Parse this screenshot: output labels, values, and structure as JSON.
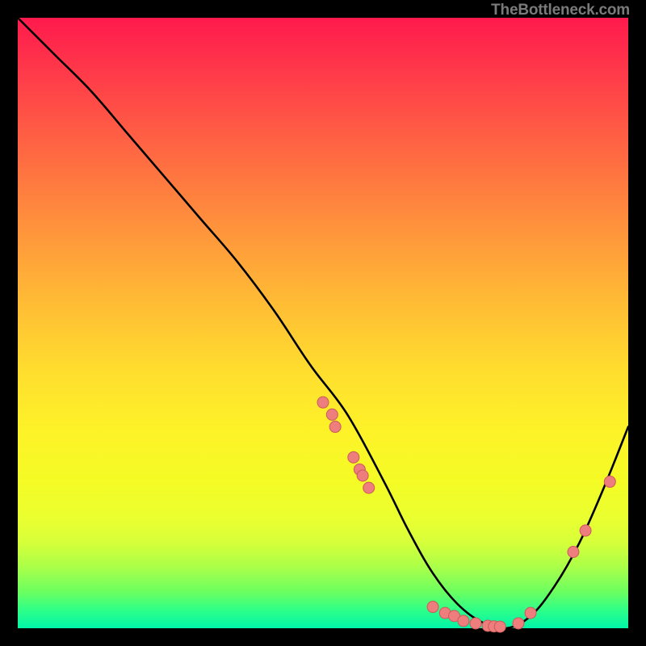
{
  "attribution": "TheBottleneck.com",
  "chart_data": {
    "type": "line",
    "title": "",
    "xlabel": "",
    "ylabel": "",
    "xlim": [
      0,
      100
    ],
    "ylim": [
      0,
      100
    ],
    "series": [
      {
        "name": "curve",
        "x": [
          0,
          6,
          12,
          18,
          24,
          30,
          36,
          42,
          48,
          54,
          60,
          64,
          68,
          72,
          76,
          80,
          84,
          88,
          92,
          96,
          100
        ],
        "values": [
          100,
          94,
          88,
          81,
          74,
          67,
          60,
          52,
          43,
          35,
          24,
          16,
          9,
          4,
          1,
          0,
          2,
          7,
          14,
          23,
          33
        ]
      }
    ],
    "markers": [
      {
        "x": 50,
        "y": 37
      },
      {
        "x": 51.5,
        "y": 35
      },
      {
        "x": 52,
        "y": 33
      },
      {
        "x": 55,
        "y": 28
      },
      {
        "x": 56,
        "y": 26
      },
      {
        "x": 56.5,
        "y": 25
      },
      {
        "x": 57.5,
        "y": 23
      },
      {
        "x": 68,
        "y": 3.5
      },
      {
        "x": 70,
        "y": 2.5
      },
      {
        "x": 71.5,
        "y": 2
      },
      {
        "x": 73,
        "y": 1.2
      },
      {
        "x": 75,
        "y": 0.8
      },
      {
        "x": 77,
        "y": 0.4
      },
      {
        "x": 78,
        "y": 0.3
      },
      {
        "x": 79,
        "y": 0.25
      },
      {
        "x": 82,
        "y": 0.8
      },
      {
        "x": 84,
        "y": 2.5
      },
      {
        "x": 91,
        "y": 12.5
      },
      {
        "x": 93,
        "y": 16
      },
      {
        "x": 97,
        "y": 24
      }
    ],
    "markerStyle": {
      "fill": "#ee7d7d",
      "stroke": "#cc5a5a",
      "radius": 7
    },
    "curveStyle": {
      "stroke": "#000000",
      "width": 2.6
    }
  }
}
